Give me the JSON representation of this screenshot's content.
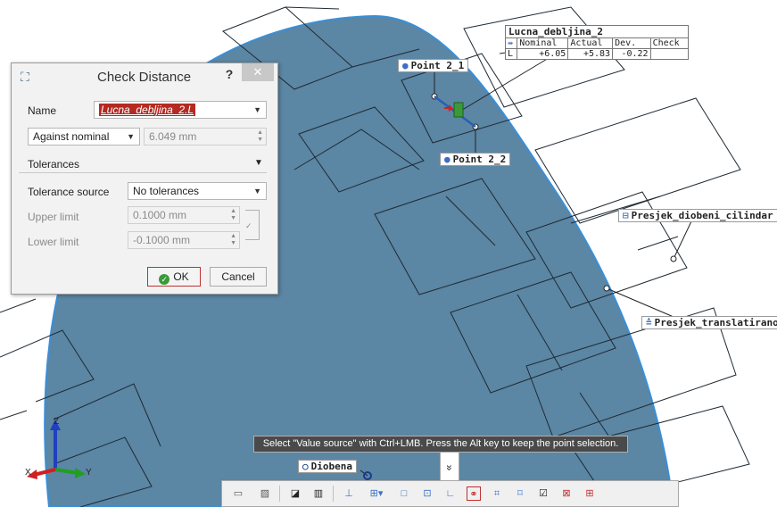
{
  "colors": {
    "body_fill": "#5b86a4",
    "body_edge": "#3a8fd8",
    "dialog_bg": "#f2f2f2",
    "ok_check": "#3a9a3a",
    "name_highlight": "#b42a22",
    "tooltip_bg": "#4a4a4a",
    "point_blue": "#3b6fc4",
    "axis_x": "#d02020",
    "axis_y": "#20a020",
    "axis_z": "#2040c0"
  },
  "dialog": {
    "title": "Check Distance",
    "help_label": "?",
    "close_label": "✕",
    "name_label": "Name",
    "name_value": "Lucna_debljina_2.L",
    "mode_value": "Against nominal",
    "nominal_value": "6.049 mm",
    "tolerances_label": "Tolerances",
    "tolerance_source_label": "Tolerance source",
    "tolerance_source_value": "No tolerances",
    "upper_limit_label": "Upper limit",
    "upper_limit_value": "0.1000 mm",
    "lower_limit_label": "Lower limit",
    "lower_limit_value": "-0.1000 mm",
    "ok_label": "OK",
    "cancel_label": "Cancel"
  },
  "labels": {
    "point_2_1": "Point 2_1",
    "point_2_2": "Point 2_2",
    "presjek_diobeni": "Presjek_diobeni_cilindar",
    "presjek_translatirano": "Presjek_translatirano",
    "diobena": "Diobena"
  },
  "measure_table": {
    "title": "Lucna_debljina_2",
    "headers": [
      "Nominal",
      "Actual",
      "Dev.",
      "Check"
    ],
    "row_label": "L",
    "nominal": "+6.05",
    "actual": "+5.83",
    "deviation": "-0.22",
    "check": ""
  },
  "hint": "Select \"Value source\" with Ctrl+LMB. Press the Alt key to keep the point selection.",
  "chevron": "»",
  "axis": {
    "x": "X",
    "y": "Y",
    "z": "Z"
  }
}
